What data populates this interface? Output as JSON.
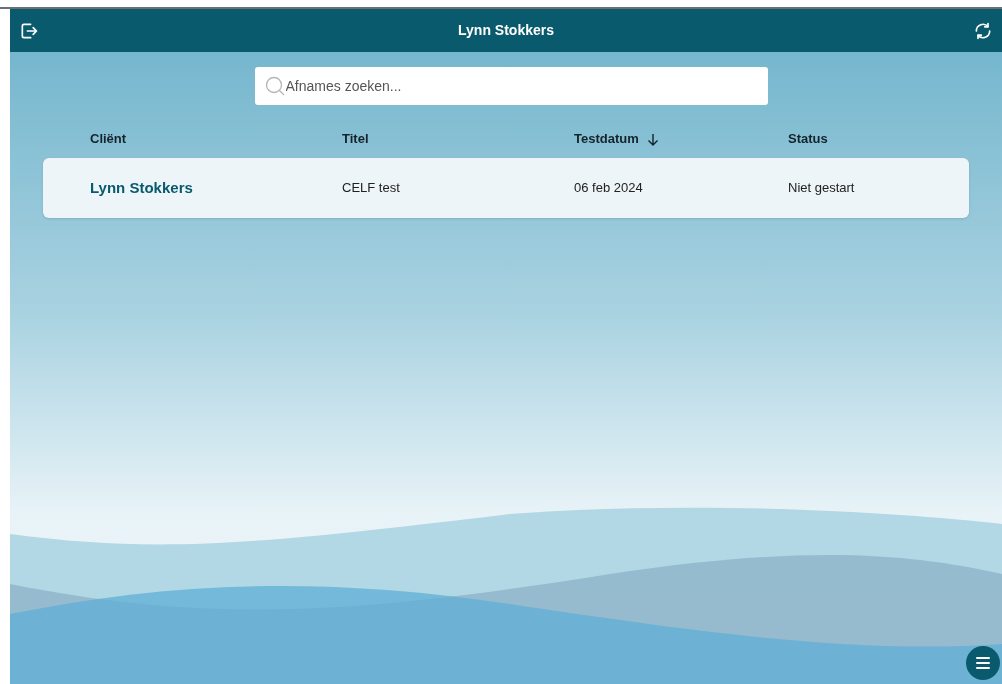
{
  "header": {
    "title": "Lynn Stokkers"
  },
  "search": {
    "placeholder": "Afnames zoeken..."
  },
  "table": {
    "columns": [
      {
        "label": "Cliënt",
        "sorted": false
      },
      {
        "label": "Titel",
        "sorted": false
      },
      {
        "label": "Testdatum",
        "sorted": true
      },
      {
        "label": "Status",
        "sorted": false
      }
    ],
    "rows": [
      {
        "cells": [
          "Lynn Stokkers",
          "CELF test",
          "06 feb 2024",
          "Niet gestart"
        ]
      }
    ]
  }
}
